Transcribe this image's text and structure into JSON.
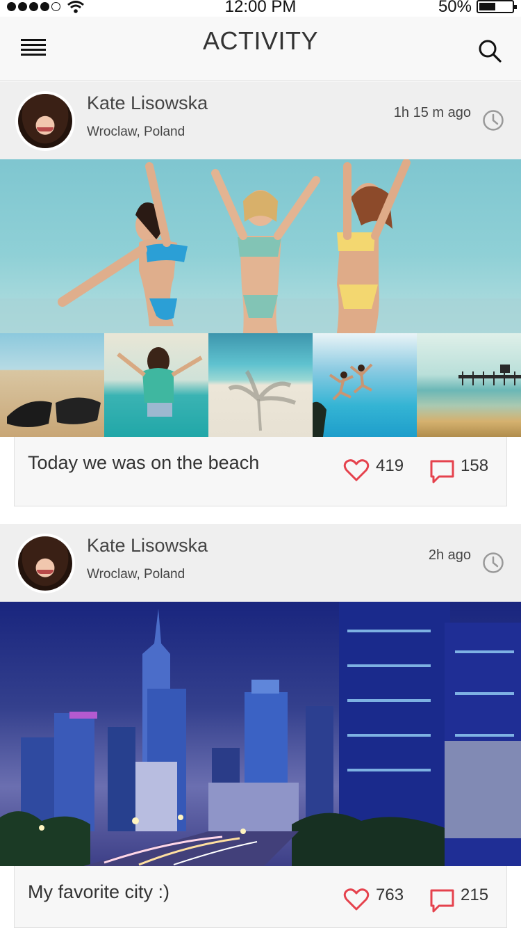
{
  "status_bar": {
    "time": "12:00 PM",
    "battery": "50%",
    "battery_level": 0.5
  },
  "header": {
    "title": "ACTIVITY",
    "menu_icon": "hamburger-icon",
    "search_icon": "search-icon"
  },
  "posts": [
    {
      "author": "Kate Lisowska",
      "location": "Wroclaw, Poland",
      "time_ago": "1h 15 m ago",
      "caption": "Today we was on the beach",
      "likes": "419",
      "comments": "158",
      "thumbnail_count": 5
    },
    {
      "author": "Kate Lisowska",
      "location": "Wroclaw, Poland",
      "time_ago": "2h ago",
      "caption": "My favorite city :)",
      "likes": "763",
      "comments": "215"
    }
  ],
  "colors": {
    "accent": "#e5424d",
    "header_bg": "#f8f8f8",
    "post_header_bg": "#efefef",
    "text": "#333333"
  }
}
